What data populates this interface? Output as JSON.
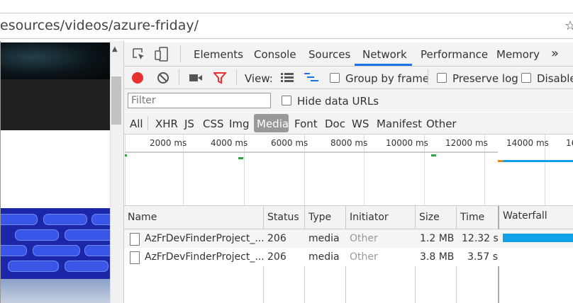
{
  "browser": {
    "address_text": "esources/videos/azure-friday/"
  },
  "devtools": {
    "tabs": [
      "Elements",
      "Console",
      "Sources",
      "Network",
      "Performance",
      "Memory"
    ],
    "active_tab": "Network",
    "more_tabs_glyph": "»",
    "toolbar": {
      "view_label": "View:",
      "group_by_frame": "Group by frame",
      "preserve_log": "Preserve log",
      "disable_cache": "Disable"
    },
    "filter": {
      "placeholder": "Filter",
      "hide_data_urls": "Hide data URLs"
    },
    "types": [
      "All",
      "XHR",
      "JS",
      "CSS",
      "Img",
      "Media",
      "Font",
      "Doc",
      "WS",
      "Manifest",
      "Other"
    ],
    "active_type": "Media",
    "overview_ticks": [
      "2000 ms",
      "4000 ms",
      "6000 ms",
      "8000 ms",
      "10000 ms",
      "12000 ms",
      "14000 ms",
      "16"
    ],
    "columns": [
      "Name",
      "Status",
      "Type",
      "Initiator",
      "Size",
      "Time",
      "Waterfall"
    ],
    "requests": [
      {
        "name": "AzFrDevFinderProject_...",
        "status": "206",
        "type": "media",
        "initiator": "Other",
        "size": "1.2 MB",
        "time": "12.32 s"
      },
      {
        "name": "AzFrDevFinderProject_...",
        "status": "206",
        "type": "media",
        "initiator": "Other",
        "size": "3.8 MB",
        "time": "3.57 s"
      }
    ]
  },
  "colors": {
    "record": "#e8312f",
    "filter_icon": "#e8312f",
    "accent": "#1a73e8",
    "waterfall_bar": "#12a1e8",
    "media_pill": "#999999"
  }
}
